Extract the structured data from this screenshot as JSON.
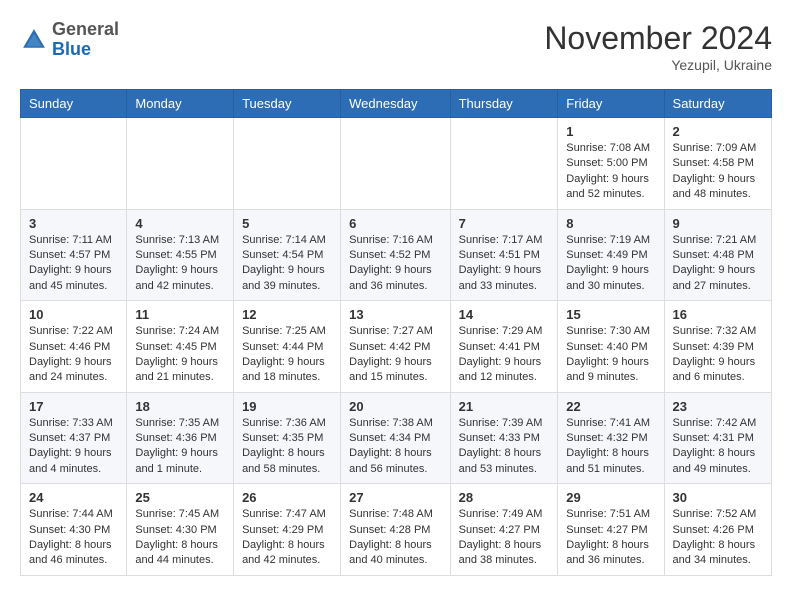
{
  "header": {
    "logo_general": "General",
    "logo_blue": "Blue",
    "month_title": "November 2024",
    "location": "Yezupil, Ukraine"
  },
  "days_of_week": [
    "Sunday",
    "Monday",
    "Tuesday",
    "Wednesday",
    "Thursday",
    "Friday",
    "Saturday"
  ],
  "weeks": [
    [
      {
        "day": "",
        "data": ""
      },
      {
        "day": "",
        "data": ""
      },
      {
        "day": "",
        "data": ""
      },
      {
        "day": "",
        "data": ""
      },
      {
        "day": "",
        "data": ""
      },
      {
        "day": "1",
        "data": "Sunrise: 7:08 AM\nSunset: 5:00 PM\nDaylight: 9 hours and 52 minutes."
      },
      {
        "day": "2",
        "data": "Sunrise: 7:09 AM\nSunset: 4:58 PM\nDaylight: 9 hours and 48 minutes."
      }
    ],
    [
      {
        "day": "3",
        "data": "Sunrise: 7:11 AM\nSunset: 4:57 PM\nDaylight: 9 hours and 45 minutes."
      },
      {
        "day": "4",
        "data": "Sunrise: 7:13 AM\nSunset: 4:55 PM\nDaylight: 9 hours and 42 minutes."
      },
      {
        "day": "5",
        "data": "Sunrise: 7:14 AM\nSunset: 4:54 PM\nDaylight: 9 hours and 39 minutes."
      },
      {
        "day": "6",
        "data": "Sunrise: 7:16 AM\nSunset: 4:52 PM\nDaylight: 9 hours and 36 minutes."
      },
      {
        "day": "7",
        "data": "Sunrise: 7:17 AM\nSunset: 4:51 PM\nDaylight: 9 hours and 33 minutes."
      },
      {
        "day": "8",
        "data": "Sunrise: 7:19 AM\nSunset: 4:49 PM\nDaylight: 9 hours and 30 minutes."
      },
      {
        "day": "9",
        "data": "Sunrise: 7:21 AM\nSunset: 4:48 PM\nDaylight: 9 hours and 27 minutes."
      }
    ],
    [
      {
        "day": "10",
        "data": "Sunrise: 7:22 AM\nSunset: 4:46 PM\nDaylight: 9 hours and 24 minutes."
      },
      {
        "day": "11",
        "data": "Sunrise: 7:24 AM\nSunset: 4:45 PM\nDaylight: 9 hours and 21 minutes."
      },
      {
        "day": "12",
        "data": "Sunrise: 7:25 AM\nSunset: 4:44 PM\nDaylight: 9 hours and 18 minutes."
      },
      {
        "day": "13",
        "data": "Sunrise: 7:27 AM\nSunset: 4:42 PM\nDaylight: 9 hours and 15 minutes."
      },
      {
        "day": "14",
        "data": "Sunrise: 7:29 AM\nSunset: 4:41 PM\nDaylight: 9 hours and 12 minutes."
      },
      {
        "day": "15",
        "data": "Sunrise: 7:30 AM\nSunset: 4:40 PM\nDaylight: 9 hours and 9 minutes."
      },
      {
        "day": "16",
        "data": "Sunrise: 7:32 AM\nSunset: 4:39 PM\nDaylight: 9 hours and 6 minutes."
      }
    ],
    [
      {
        "day": "17",
        "data": "Sunrise: 7:33 AM\nSunset: 4:37 PM\nDaylight: 9 hours and 4 minutes."
      },
      {
        "day": "18",
        "data": "Sunrise: 7:35 AM\nSunset: 4:36 PM\nDaylight: 9 hours and 1 minute."
      },
      {
        "day": "19",
        "data": "Sunrise: 7:36 AM\nSunset: 4:35 PM\nDaylight: 8 hours and 58 minutes."
      },
      {
        "day": "20",
        "data": "Sunrise: 7:38 AM\nSunset: 4:34 PM\nDaylight: 8 hours and 56 minutes."
      },
      {
        "day": "21",
        "data": "Sunrise: 7:39 AM\nSunset: 4:33 PM\nDaylight: 8 hours and 53 minutes."
      },
      {
        "day": "22",
        "data": "Sunrise: 7:41 AM\nSunset: 4:32 PM\nDaylight: 8 hours and 51 minutes."
      },
      {
        "day": "23",
        "data": "Sunrise: 7:42 AM\nSunset: 4:31 PM\nDaylight: 8 hours and 49 minutes."
      }
    ],
    [
      {
        "day": "24",
        "data": "Sunrise: 7:44 AM\nSunset: 4:30 PM\nDaylight: 8 hours and 46 minutes."
      },
      {
        "day": "25",
        "data": "Sunrise: 7:45 AM\nSunset: 4:30 PM\nDaylight: 8 hours and 44 minutes."
      },
      {
        "day": "26",
        "data": "Sunrise: 7:47 AM\nSunset: 4:29 PM\nDaylight: 8 hours and 42 minutes."
      },
      {
        "day": "27",
        "data": "Sunrise: 7:48 AM\nSunset: 4:28 PM\nDaylight: 8 hours and 40 minutes."
      },
      {
        "day": "28",
        "data": "Sunrise: 7:49 AM\nSunset: 4:27 PM\nDaylight: 8 hours and 38 minutes."
      },
      {
        "day": "29",
        "data": "Sunrise: 7:51 AM\nSunset: 4:27 PM\nDaylight: 8 hours and 36 minutes."
      },
      {
        "day": "30",
        "data": "Sunrise: 7:52 AM\nSunset: 4:26 PM\nDaylight: 8 hours and 34 minutes."
      }
    ]
  ]
}
